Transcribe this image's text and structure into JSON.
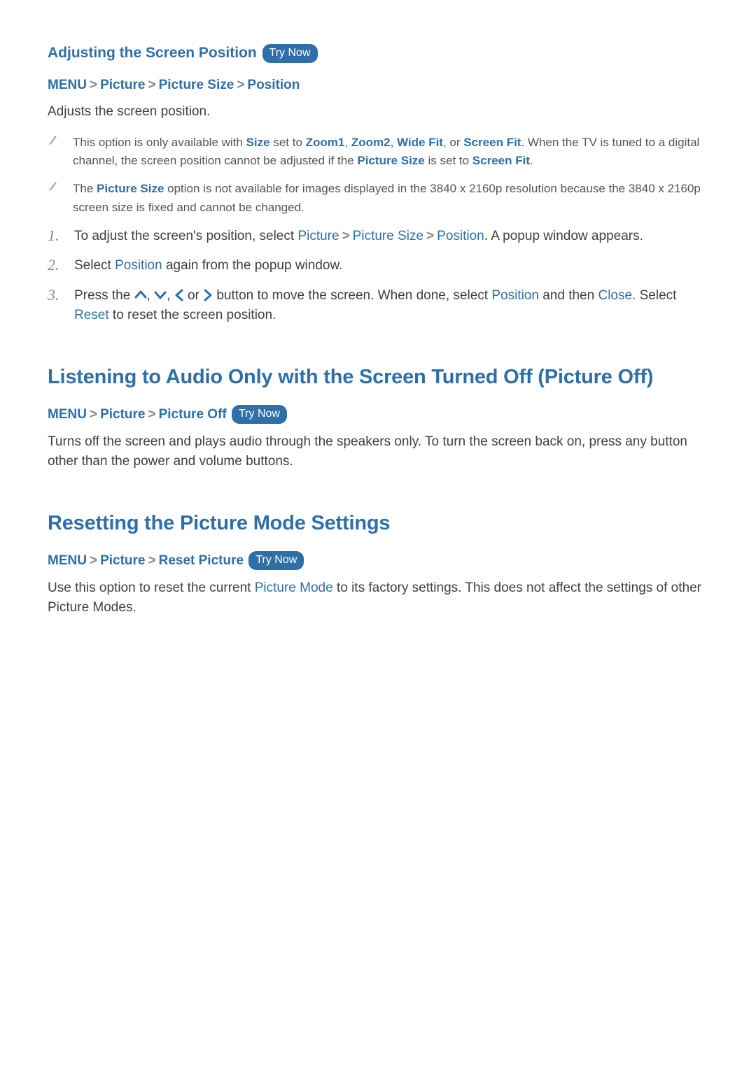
{
  "tryNow": "Try Now",
  "sec1": {
    "heading": "Adjusting the Screen Position",
    "crumbs": [
      "MENU",
      "Picture",
      "Picture Size",
      "Position"
    ],
    "intro": "Adjusts the screen position.",
    "note1": {
      "p1": "This option is only available with ",
      "size": "Size",
      "p2": " set to ",
      "z1": "Zoom1",
      "c1": ", ",
      "z2": "Zoom2",
      "c2": ", ",
      "wf": "Wide Fit",
      "c3": ", or ",
      "sf": "Screen Fit",
      "p3": ". When the TV is tuned to a digital channel, the screen position cannot be adjusted if the ",
      "ps": "Picture Size",
      "p4": " is set to ",
      "sf2": "Screen Fit",
      "p5": "."
    },
    "note2": {
      "p1": "The ",
      "ps": "Picture Size",
      "p2": " option is not available for images displayed in the 3840 x 2160p resolution because the 3840 x 2160p screen size is fixed and cannot be changed."
    },
    "step1": {
      "a": "To adjust the screen's position, select ",
      "pic": "Picture",
      "psz": "Picture Size",
      "pos": "Position",
      "b": ". A popup window appears."
    },
    "step2": {
      "a": "Select ",
      "pos": "Position",
      "b": " again from the popup window."
    },
    "step3": {
      "a": "Press the ",
      "b": " or ",
      "c": " button to move the screen. When done, select ",
      "pos": "Position",
      "d": " and then ",
      "close": "Close",
      "e": ". Select ",
      "reset": "Reset",
      "f": " to reset the screen position."
    }
  },
  "sec2": {
    "heading": "Listening to Audio Only with the Screen Turned Off (Picture Off)",
    "crumbs": [
      "MENU",
      "Picture",
      "Picture Off"
    ],
    "body": "Turns off the screen and plays audio through the speakers only. To turn the screen back on, press any button other than the power and volume buttons."
  },
  "sec3": {
    "heading": "Resetting the Picture Mode Settings",
    "crumbs": [
      "MENU",
      "Picture",
      "Reset Picture"
    ],
    "body": {
      "a": "Use this option to reset the current ",
      "pm": "Picture Mode",
      "b": " to its factory settings. This does not affect the settings of other Picture Modes."
    }
  }
}
